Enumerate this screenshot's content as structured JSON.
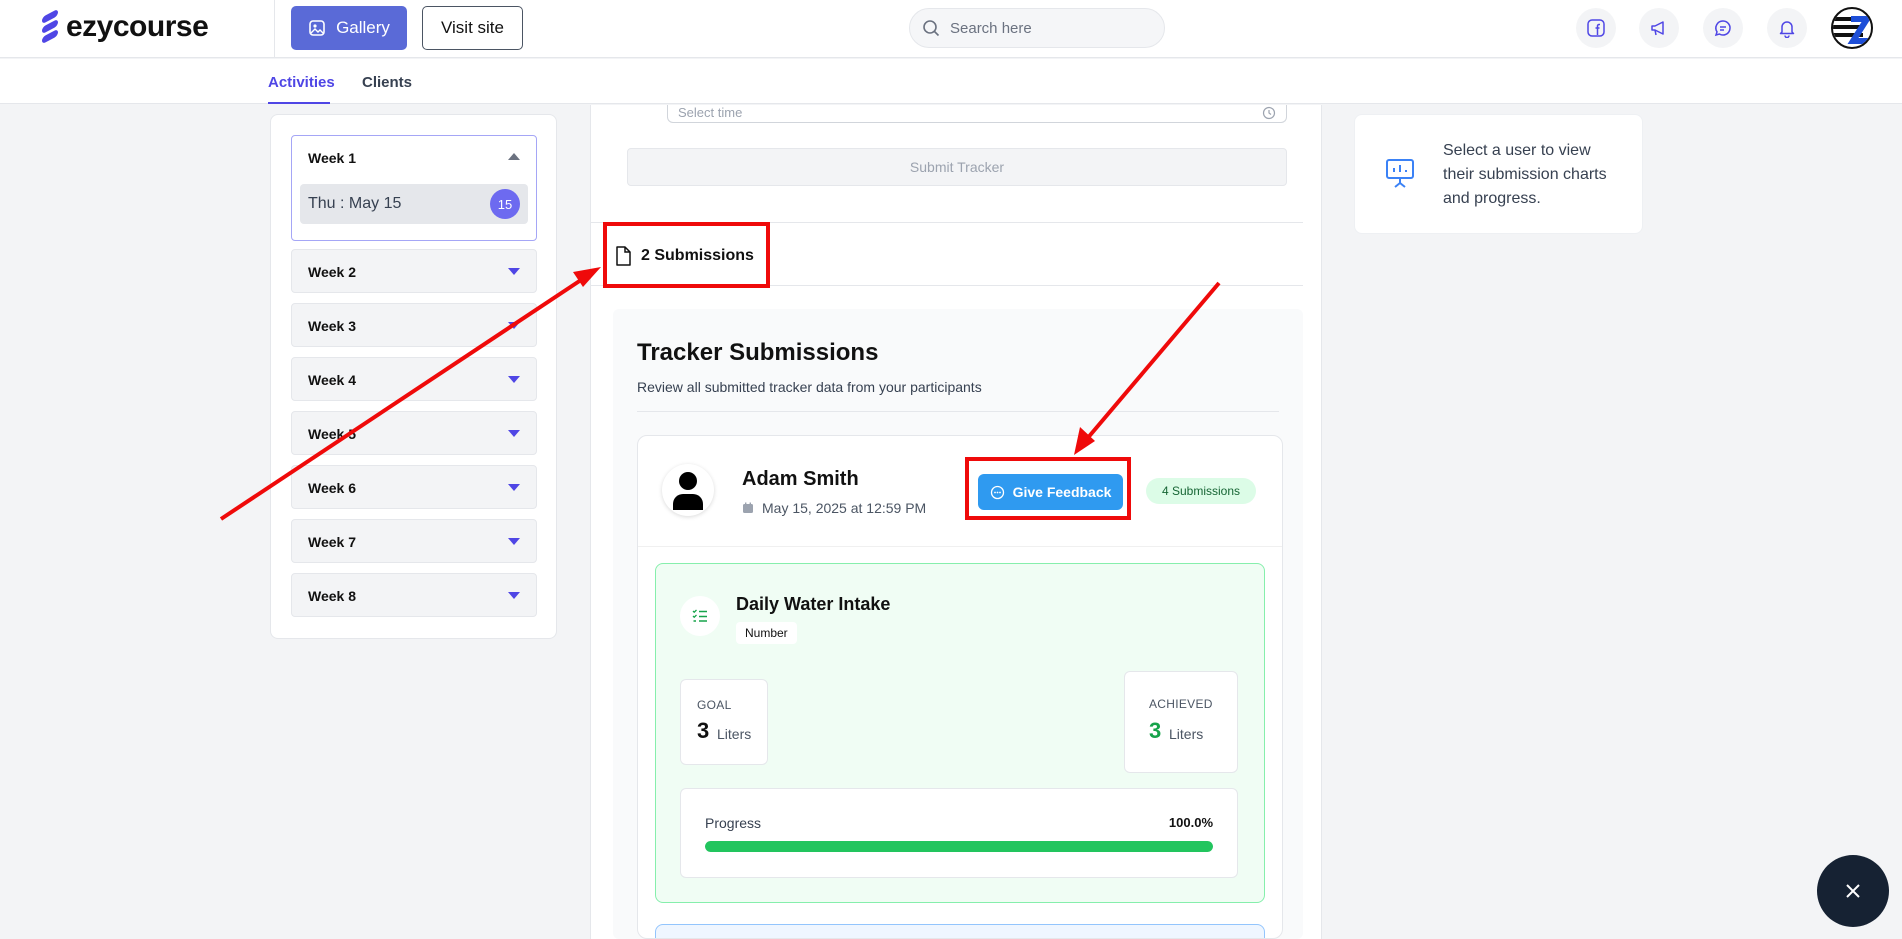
{
  "header": {
    "logo_text": "ezycourse",
    "gallery_label": "Gallery",
    "visit_site_label": "Visit site",
    "search_placeholder": "Search here",
    "icons": [
      "facebook-icon",
      "megaphone-icon",
      "chat-icon",
      "bell-icon",
      "profile-avatar"
    ]
  },
  "tabs": [
    {
      "label": "Activities",
      "active": true
    },
    {
      "label": "Clients",
      "active": false
    }
  ],
  "weeks": {
    "open_week": "Week 1",
    "day_label": "Thu : May 15",
    "day_count": "15",
    "items": [
      "Week 2",
      "Week 3",
      "Week 4",
      "Week 5",
      "Week 6",
      "Week 7",
      "Week 8"
    ]
  },
  "form": {
    "time_placeholder": "Select time",
    "submit_label": "Submit Tracker"
  },
  "submissions_tab": "2 Submissions",
  "tracker": {
    "title": "Tracker Submissions",
    "subtitle": "Review all submitted tracker data from your participants",
    "user_name": "Adam Smith",
    "user_date": "May 15, 2025 at 12:59 PM",
    "feedback_label": "Give Feedback",
    "submissions_badge": "4 Submissions",
    "metric": {
      "name": "Daily Water Intake",
      "type": "Number",
      "goal_label": "GOAL",
      "goal_value": "3",
      "goal_unit": "Liters",
      "achieved_label": "ACHIEVED",
      "achieved_value": "3",
      "achieved_unit": "Liters",
      "progress_label": "Progress",
      "progress_text": "100.0%",
      "progress_fraction": 1.0
    }
  },
  "info": {
    "text": "Select a user to view their submission charts and progress."
  },
  "colors": {
    "primary": "#4f46e5",
    "gallery_button": "#5a6ad7",
    "feedback_button": "#2f9af0",
    "success": "#22c55e",
    "annotation": "#ef0a0a"
  }
}
